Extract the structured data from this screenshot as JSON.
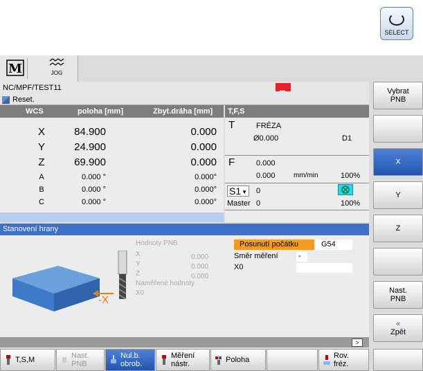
{
  "select_key": {
    "label": "SELECT"
  },
  "topbar": {
    "jog_label": "JOG"
  },
  "channel": {
    "program": "NC/MPF/TEST11",
    "status": "Reset."
  },
  "coordinates": {
    "headers": {
      "wcs": "WCS",
      "position": "poloha [mm]",
      "distance": "Zbyt.dráha [mm]"
    },
    "rows": [
      {
        "axis": "X",
        "position": "84.900",
        "distance": "0.000"
      },
      {
        "axis": "Y",
        "position": "24.900",
        "distance": "0.000"
      },
      {
        "axis": "Z",
        "position": "69.900",
        "distance": "0.000"
      },
      {
        "axis": "A",
        "position": "0.000 °",
        "distance": "0.000°"
      },
      {
        "axis": "B",
        "position": "0.000 °",
        "distance": "0.000°"
      },
      {
        "axis": "C",
        "position": "0.000 °",
        "distance": "0.000°"
      }
    ]
  },
  "tfs": {
    "header": "T,F,S",
    "t_label": "T",
    "tool_name": "FRÉZA",
    "tool_diameter": "Ø0.000",
    "tool_d": "D1",
    "f_label": "F",
    "feed_1": "0.000",
    "feed_2": "0.000",
    "feed_unit": "mm/min",
    "feed_pct": "100%",
    "spindle": "S1",
    "spindle_val": "0",
    "master_label": "Master",
    "master_val": "0",
    "spindle_pct": "100%"
  },
  "panel": {
    "title": "Stanovení hrany",
    "pnb_title": "Hodnoty PNB",
    "pnb_x_label": "X",
    "pnb_x_val": "0.000",
    "pnb_y_label": "Y",
    "pnb_y_val": "0.000",
    "pnb_z_label": "Z",
    "pnb_z_val": "0.000",
    "measured_label": "Naměřené hodnoty",
    "measured_x0": "X0",
    "offset_label": "Posunutí počátku",
    "offset_value": "G54",
    "direction_label": "Směr měření",
    "direction_value": "-",
    "x0_label": "X0",
    "x0_value": "",
    "minus_x": "-X",
    "scroll_label": ">"
  },
  "vertical_softkeys": [
    {
      "label1": "Vybrat",
      "label2": "PNB",
      "active": false
    },
    {
      "label1": "",
      "label2": "",
      "active": false
    },
    {
      "label1": "X",
      "label2": "",
      "active": true
    },
    {
      "label1": "Y",
      "label2": "",
      "active": false
    },
    {
      "label1": "Z",
      "label2": "",
      "active": false
    },
    {
      "label1": "",
      "label2": "",
      "active": false
    },
    {
      "label1": "Nast.",
      "label2": "PNB",
      "active": false
    },
    {
      "label1": "«",
      "label2": "Zpět",
      "active": false
    }
  ],
  "bottom_softkeys": [
    {
      "label1": "T,S,M",
      "label2": ""
    },
    {
      "label1": "Nast.",
      "label2": "PNB"
    },
    {
      "label1": "Nul.b.",
      "label2": "obrob."
    },
    {
      "label1": "Měření",
      "label2": "nástr."
    },
    {
      "label1": "Poloha",
      "label2": ""
    },
    {
      "label1": "",
      "label2": ""
    },
    {
      "label1": "Rov.",
      "label2": "fréz."
    },
    {
      "label1": "",
      "label2": ""
    }
  ]
}
